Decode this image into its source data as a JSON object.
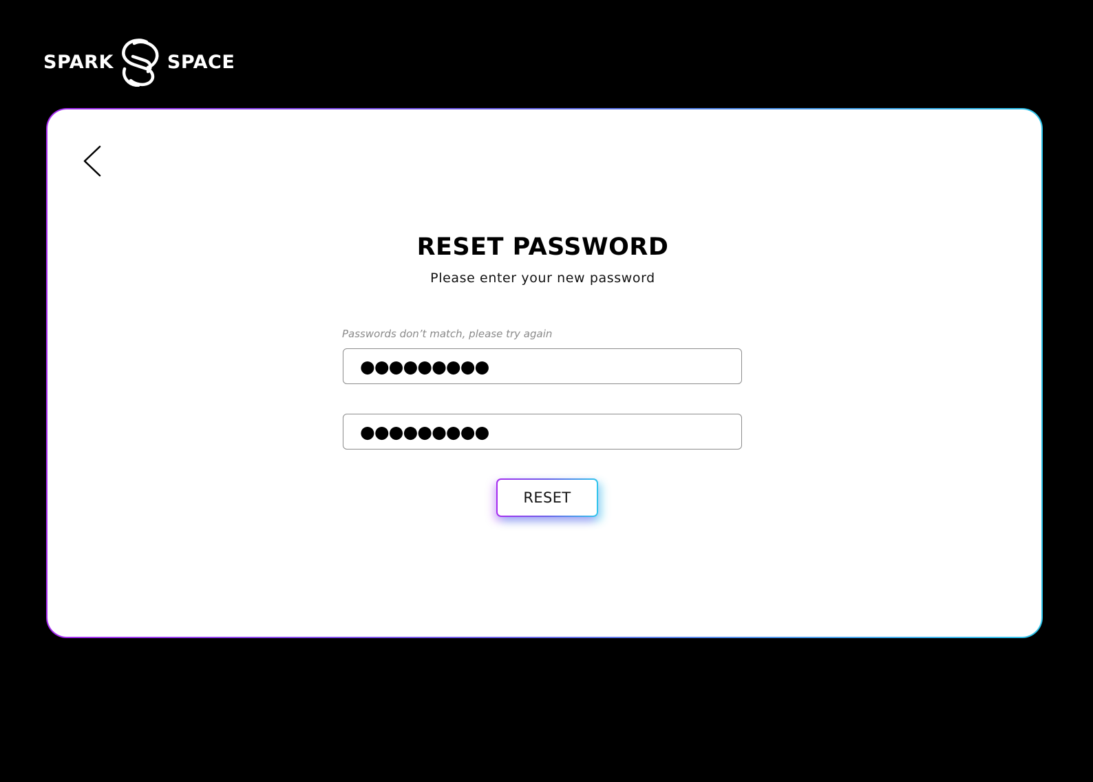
{
  "brand": {
    "left_word": "SPARK",
    "right_word": "SPACE",
    "logo_icon": "spark-space-logo-icon"
  },
  "colors": {
    "background": "#000000",
    "card": "#ffffff",
    "gradient_start": "#a62bf0",
    "gradient_end": "#2fc5ec",
    "error_text": "#8a8a8a"
  },
  "back_button": {
    "icon": "chevron-left-icon"
  },
  "reset_form": {
    "title": "RESET PASSWORD",
    "subtitle": "Please enter your new password",
    "error_message": "Passwords don’t match, please try again",
    "new_password_value": "●●●●●●●●●",
    "confirm_password_value": "●●●●●●●●●",
    "submit_label": "RESET"
  }
}
